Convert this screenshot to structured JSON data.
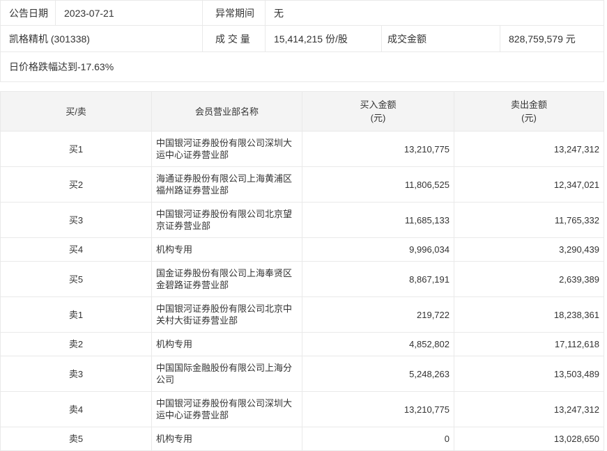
{
  "summary": {
    "announce_date_label": "公告日期",
    "announce_date": "2023-07-21",
    "abnormal_period_label": "异常期间",
    "abnormal_period": "无",
    "stock_name_code": "凯格精机 (301338)",
    "volume_label": "成 交 量",
    "volume_value": "15,414,215 份/股",
    "turnover_label": "成交金额",
    "turnover_value": "828,759,579 元",
    "reason_note": "日价格跌幅达到-17.63%"
  },
  "table": {
    "headers": {
      "side": "买/卖",
      "branch": "会员营业部名称",
      "buy_amount": "买入金额",
      "buy_unit": "(元)",
      "sell_amount": "卖出金额",
      "sell_unit": "(元)"
    },
    "rows": [
      {
        "side": "买1",
        "branch": "中国银河证券股份有限公司深圳大运中心证券营业部",
        "buy": "13,210,775",
        "sell": "13,247,312"
      },
      {
        "side": "买2",
        "branch": "海通证券股份有限公司上海黄浦区福州路证券营业部",
        "buy": "11,806,525",
        "sell": "12,347,021"
      },
      {
        "side": "买3",
        "branch": "中国银河证券股份有限公司北京望京证券营业部",
        "buy": "11,685,133",
        "sell": "11,765,332"
      },
      {
        "side": "买4",
        "branch": "机构专用",
        "buy": "9,996,034",
        "sell": "3,290,439"
      },
      {
        "side": "买5",
        "branch": "国金证券股份有限公司上海奉贤区金碧路证券营业部",
        "buy": "8,867,191",
        "sell": "2,639,389"
      },
      {
        "side": "卖1",
        "branch": "中国银河证券股份有限公司北京中关村大街证券营业部",
        "buy": "219,722",
        "sell": "18,238,361"
      },
      {
        "side": "卖2",
        "branch": "机构专用",
        "buy": "4,852,802",
        "sell": "17,112,618"
      },
      {
        "side": "卖3",
        "branch": "中国国际金融股份有限公司上海分公司",
        "buy": "5,248,263",
        "sell": "13,503,489"
      },
      {
        "side": "卖4",
        "branch": "中国银河证券股份有限公司深圳大运中心证券营业部",
        "buy": "13,210,775",
        "sell": "13,247,312"
      },
      {
        "side": "卖5",
        "branch": "机构专用",
        "buy": "0",
        "sell": "13,028,650"
      }
    ]
  },
  "colors": {
    "border": "#e9e9e9",
    "header_bg": "#f4f4f4",
    "text": "#333333",
    "background": "#ffffff"
  }
}
